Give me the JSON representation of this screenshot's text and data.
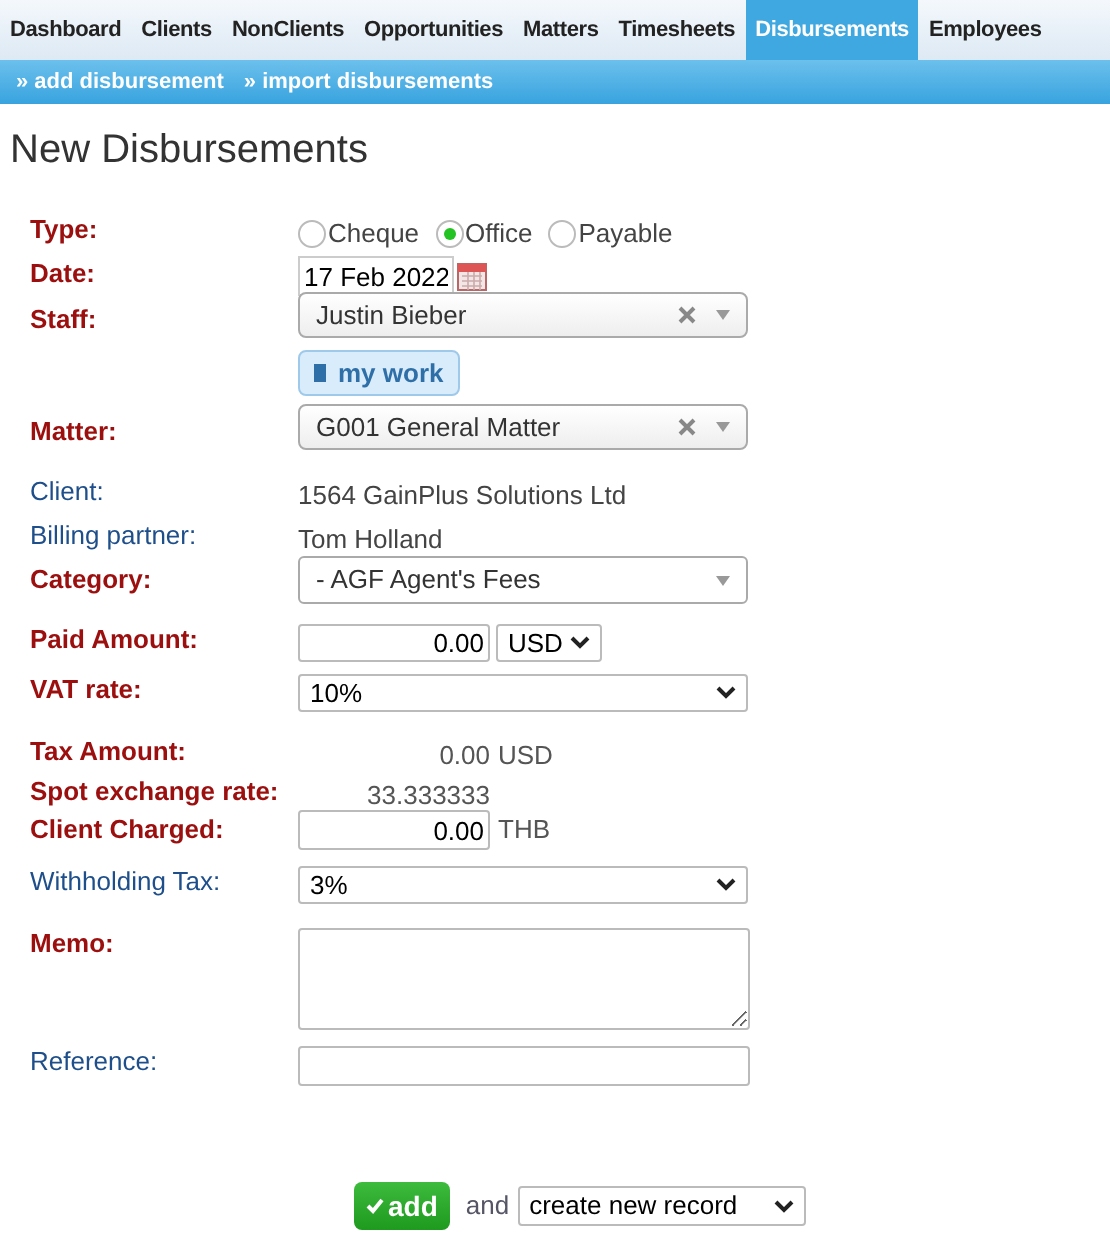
{
  "nav": [
    {
      "label": "Dashboard",
      "selected": false
    },
    {
      "label": "Clients",
      "selected": false
    },
    {
      "label": "NonClients",
      "selected": false
    },
    {
      "label": "Opportunities",
      "selected": false
    },
    {
      "label": "Matters",
      "selected": false
    },
    {
      "label": "Timesheets",
      "selected": false
    },
    {
      "label": "Disbursements",
      "selected": true
    },
    {
      "label": "Employees",
      "selected": false
    }
  ],
  "subnav": [
    "» add disbursement",
    "» import disbursements"
  ],
  "heading": "New Disbursements",
  "rows": [
    {
      "kind": "radio",
      "label": "Type:",
      "required": true,
      "options": [
        {
          "label": "Cheque",
          "selected": false
        },
        {
          "label": "Office",
          "selected": true
        },
        {
          "label": "Payable",
          "selected": false
        }
      ]
    },
    {
      "kind": "date",
      "label": "Date:",
      "required": true,
      "value": "17 Feb 2022"
    },
    {
      "kind": "combo",
      "label": "Staff:",
      "required": true,
      "value": "Justin Bieber",
      "button": "my work"
    },
    {
      "kind": "combo",
      "label": "Matter:",
      "required": true,
      "value": "G001 General Matter"
    },
    {
      "kind": "display",
      "label": "Client:",
      "required": false,
      "value": "1564 GainPlus Solutions Ltd"
    },
    {
      "kind": "display",
      "label": "Billing partner:",
      "required": false,
      "value": "Tom Holland"
    },
    {
      "kind": "category",
      "label": "Category:",
      "required": true,
      "value": "- AGF Agent's Fees"
    },
    {
      "kind": "amount",
      "label": "Paid Amount:",
      "required": true,
      "value": "0.00",
      "currency": "USD"
    },
    {
      "kind": "select",
      "label": "VAT rate:",
      "required": true,
      "value": "10%"
    },
    {
      "kind": "readout",
      "label": "Tax Amount:",
      "required": true,
      "value": "0.00",
      "unit": "USD"
    },
    {
      "kind": "readout",
      "label": "Spot exchange rate:",
      "required": true,
      "value": "33.333333"
    },
    {
      "kind": "charged",
      "label": "Client Charged:",
      "required": true,
      "value": "0.00",
      "unit": "THB"
    },
    {
      "kind": "select",
      "label": "Withholding Tax:",
      "required": false,
      "value": "3%"
    },
    {
      "kind": "textarea",
      "label": "Memo:",
      "required": true
    },
    {
      "kind": "input",
      "label": "Reference:",
      "required": false
    }
  ],
  "footer": {
    "button": "add",
    "joiner": "and",
    "action": "create new record"
  }
}
